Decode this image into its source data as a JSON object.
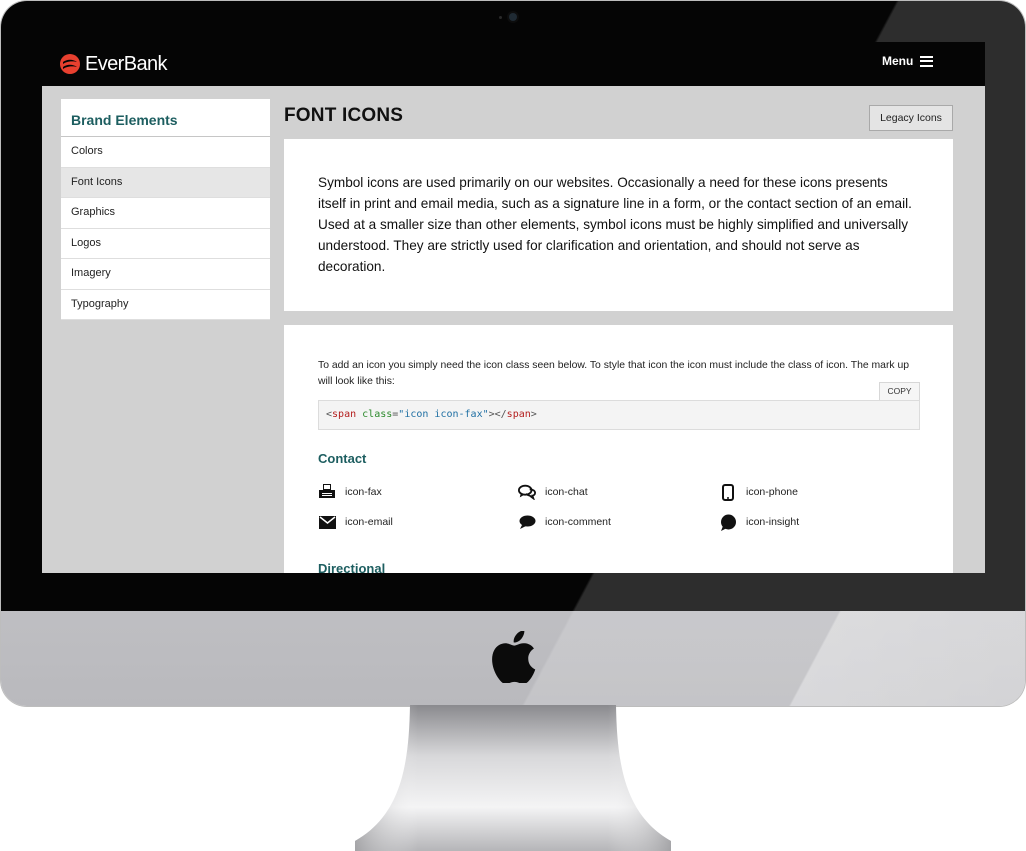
{
  "header": {
    "logo": "EverBank",
    "menu_label": "Menu"
  },
  "sidebar": {
    "title": "Brand Elements",
    "items": [
      {
        "label": "Colors"
      },
      {
        "label": "Font Icons",
        "active": true
      },
      {
        "label": "Graphics"
      },
      {
        "label": "Logos"
      },
      {
        "label": "Imagery"
      },
      {
        "label": "Typography"
      }
    ]
  },
  "main": {
    "title": "FONT ICONS",
    "legacy_button": "Legacy Icons",
    "intro": "Symbol icons are used primarily on our websites. Occasionally a need for these icons presents itself in print and email media, such as a signature line in a form, or the contact section of an email. Used at a smaller size than other elements, symbol icons must be highly simplified and universally understood. They are strictly used for clarification and orientation, and should not serve as decoration.",
    "instructions": "To add an icon you simply need the icon class seen below. To style that icon the icon must include the class of icon. The mark up will look like this:",
    "copy_label": "COPY",
    "code": {
      "open": "<",
      "tag": "span",
      "attr": "class",
      "eq": "=",
      "value": "\"icon icon-fax\"",
      "close_open": "></",
      "close_tag": "span",
      "end": ">"
    },
    "sections": [
      {
        "title": "Contact",
        "icons": [
          {
            "name": "icon-fax",
            "icon": "fax-icon"
          },
          {
            "name": "icon-chat",
            "icon": "chat-icon"
          },
          {
            "name": "icon-phone",
            "icon": "phone-icon"
          },
          {
            "name": "icon-email",
            "icon": "email-icon"
          },
          {
            "name": "icon-comment",
            "icon": "comment-icon"
          },
          {
            "name": "icon-insight",
            "icon": "insight-icon"
          }
        ]
      },
      {
        "title": "Directional"
      }
    ]
  },
  "colors": {
    "accent": "#1d5e60",
    "brand_red": "#e8402f",
    "screen_bg": "#d1d1d1",
    "topbar": "#050505"
  }
}
